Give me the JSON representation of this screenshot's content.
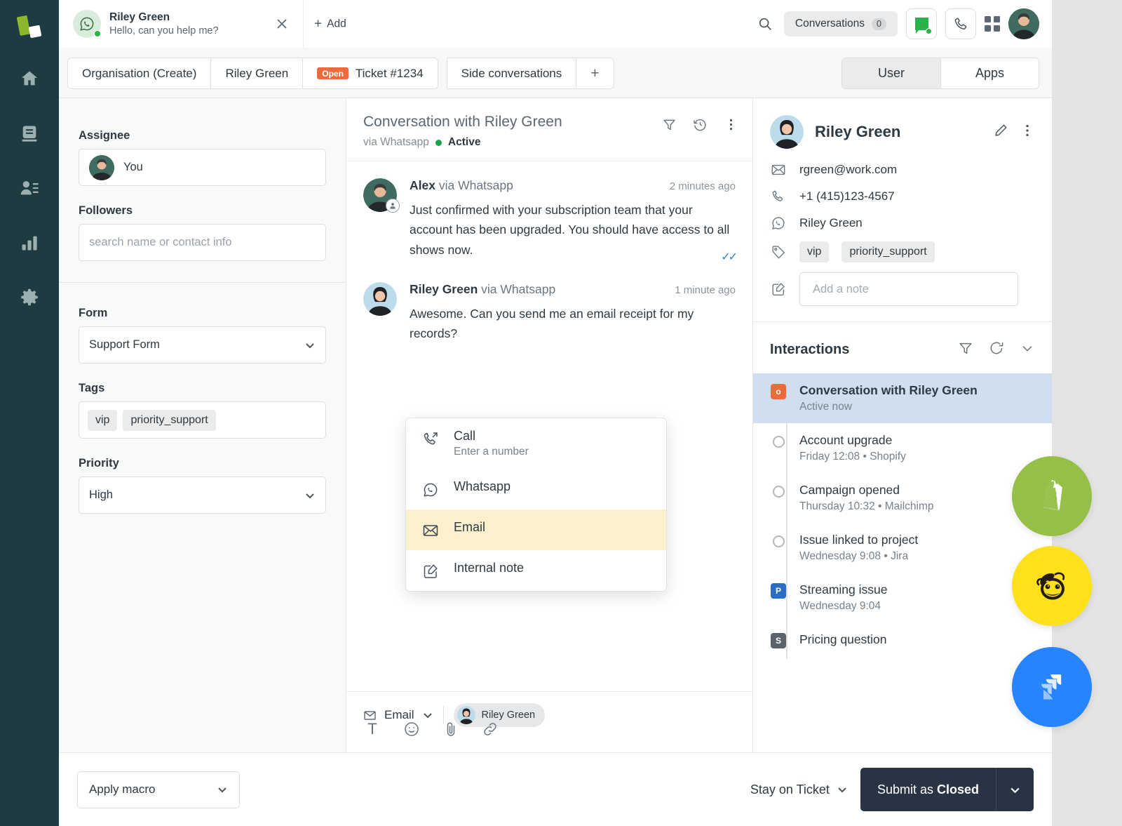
{
  "colors": {
    "rail_bg": "#1d3b40",
    "accent_orange": "#ed6a3a",
    "active_green": "#15a54a",
    "submit_dark": "#283444",
    "highlight_yellow": "#fbf0cd",
    "timeline_selected": "#cfdfef",
    "shopify_green": "#95bf47",
    "mailchimp_yellow": "#ffe01b",
    "jira_blue": "#2684ff"
  },
  "rail": {
    "items": [
      {
        "name": "logo",
        "label": "Logo"
      },
      {
        "name": "home",
        "label": "Home"
      },
      {
        "name": "tickets",
        "label": "Tickets"
      },
      {
        "name": "contacts",
        "label": "Contacts"
      },
      {
        "name": "reports",
        "label": "Reports"
      },
      {
        "name": "settings",
        "label": "Settings"
      }
    ]
  },
  "topbar": {
    "conversation_tab": {
      "name": "Riley Green",
      "preview": "Hello, can you help me?",
      "channel_icon": "whatsapp-icon",
      "online": true
    },
    "add_label": "Add",
    "search_icon": "search-icon",
    "queue": {
      "label": "Conversations",
      "count": "0"
    },
    "chat_button_icon": "chat-bubble-icon",
    "call_button_icon": "phone-icon",
    "apps_grid_icon": "grid-icon",
    "avatar_icon": "user-avatar"
  },
  "tabstrip": {
    "tabs": [
      {
        "label": "Organisation (Create)",
        "badge": null
      },
      {
        "label": "Riley Green",
        "badge": null
      },
      {
        "label": "Ticket #1234",
        "badge": "Open"
      }
    ],
    "side_tab": "Side conversations",
    "add_tab_icon": "plus-icon",
    "segments": [
      {
        "label": "User",
        "active": true
      },
      {
        "label": "Apps",
        "active": false
      }
    ]
  },
  "properties": {
    "assignee": {
      "label": "Assignee",
      "value": "You"
    },
    "followers": {
      "label": "Followers",
      "placeholder": "search name or contact info"
    },
    "form": {
      "label": "Form",
      "value": "Support Form"
    },
    "tags": {
      "label": "Tags",
      "values": [
        "vip",
        "priority_support"
      ]
    },
    "priority": {
      "label": "Priority",
      "value": "High"
    }
  },
  "conversation": {
    "title": "Conversation with Riley Green",
    "via": "via Whatsapp",
    "status": "Active",
    "actions": [
      "filter-icon",
      "history-icon",
      "more-vertical-icon"
    ],
    "messages": [
      {
        "author": "Alex",
        "via": "via Whatsapp",
        "time": "2 minutes ago",
        "text": "Just confirmed with your subscription team that your account has been upgraded. You should have access to all shows now.",
        "read_receipt": true,
        "is_agent": true
      },
      {
        "author": "Riley Green",
        "via": "via Whatsapp",
        "time": "1 minute ago",
        "text": "Awesome. Can you send me an email receipt for my records?",
        "read_receipt": false,
        "is_agent": false
      }
    ]
  },
  "channel_menu": {
    "items": [
      {
        "title": "Call",
        "subtitle": "Enter a number",
        "icon": "phone-outgoing-icon",
        "highlighted": false
      },
      {
        "title": "Whatsapp",
        "subtitle": "",
        "icon": "whatsapp-icon",
        "highlighted": false
      },
      {
        "title": "Email",
        "subtitle": "",
        "icon": "envelope-icon",
        "highlighted": true
      },
      {
        "title": "Internal note",
        "subtitle": "",
        "icon": "note-edit-icon",
        "highlighted": false
      }
    ]
  },
  "composer": {
    "channel": "Email",
    "recipient": "Riley Green",
    "tools": [
      {
        "name": "text-format-icon",
        "glyph": "T"
      },
      {
        "name": "emoji-icon",
        "glyph": ""
      },
      {
        "name": "attachment-icon",
        "glyph": ""
      },
      {
        "name": "link-icon",
        "glyph": ""
      }
    ]
  },
  "footer": {
    "macro_label": "Apply macro",
    "stay_label": "Stay on Ticket",
    "submit_prefix": "Submit as ",
    "submit_state": "Closed"
  },
  "contact": {
    "name": "Riley Green",
    "edit_icon": "pencil-icon",
    "more_icon": "more-vertical-icon",
    "email": "rgreen@work.com",
    "phone": "+1 (415)123-4567",
    "whatsapp": "Riley Green",
    "tags": [
      "vip",
      "priority_support"
    ],
    "note_placeholder": "Add a note"
  },
  "interactions": {
    "title": "Interactions",
    "actions": [
      "filter-icon",
      "refresh-icon",
      "chevron-down-icon"
    ],
    "items": [
      {
        "title": "Conversation with Riley Green",
        "meta": "Active now",
        "marker": "square",
        "marker_letter": "o",
        "marker_color": "#ed6a3a",
        "selected": true
      },
      {
        "title": "Account upgrade",
        "meta": "Friday 12:08 • Shopify",
        "marker": "ring",
        "marker_letter": "",
        "marker_color": "",
        "selected": false
      },
      {
        "title": "Campaign opened",
        "meta": "Thursday 10:32 • Mailchimp",
        "marker": "ring",
        "marker_letter": "",
        "marker_color": "",
        "selected": false
      },
      {
        "title": "Issue linked to project",
        "meta": "Wednesday 9:08 • Jira",
        "marker": "ring",
        "marker_letter": "",
        "marker_color": "",
        "selected": false
      },
      {
        "title": "Streaming issue",
        "meta": "Wednesday 9:04",
        "marker": "square",
        "marker_letter": "P",
        "marker_color": "#2b6cc4",
        "selected": false
      },
      {
        "title": "Pricing question",
        "meta": "",
        "marker": "square",
        "marker_letter": "S",
        "marker_color": "#5a636c",
        "selected": false
      }
    ]
  },
  "app_badges": [
    {
      "name": "shopify",
      "label": "Shopify",
      "color": "#95bf47"
    },
    {
      "name": "mailchimp",
      "label": "Mailchimp",
      "color": "#ffe01b"
    },
    {
      "name": "jira",
      "label": "Jira",
      "color": "#2684ff"
    }
  ]
}
